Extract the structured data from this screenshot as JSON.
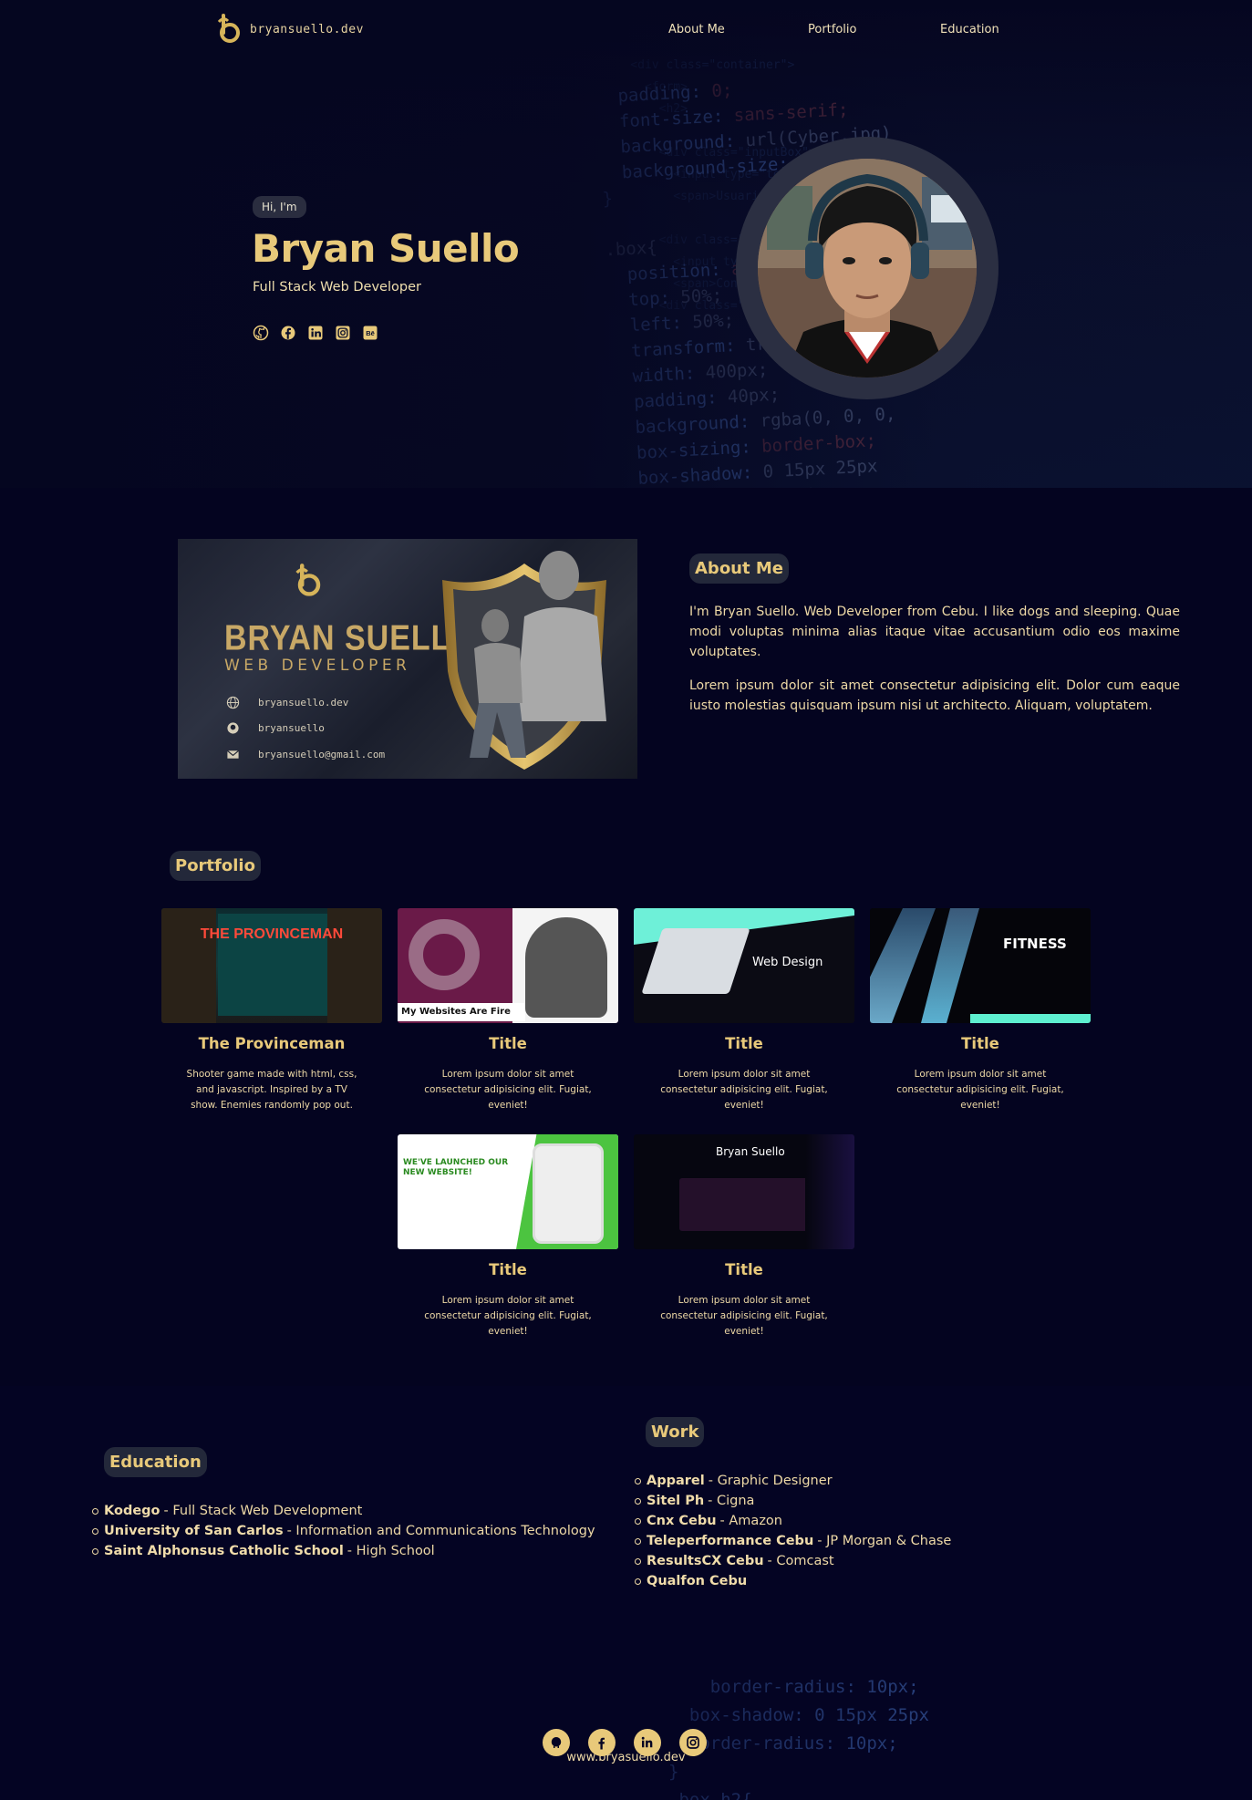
{
  "nav": {
    "logo_text": "bryansuello.dev",
    "links": [
      "About Me",
      "Portfolio",
      "Education"
    ]
  },
  "hero": {
    "greeting": "Hi, I'm",
    "name": "Bryan Suello",
    "role": "Full Stack Web Developer",
    "social_icons": [
      "github-icon",
      "facebook-icon",
      "linkedin-icon",
      "instagram-icon",
      "behance-icon"
    ]
  },
  "business_card": {
    "name": "BRYAN SUELLO",
    "title": "WEB DEVELOPER",
    "lines": [
      "bryansuello.dev",
      "bryansuello",
      "bryansuello@gmail.com"
    ]
  },
  "about": {
    "heading": "About Me",
    "paragraphs": [
      "I'm Bryan Suello. Web Developer from Cebu. I like dogs and sleeping. Quae modi voluptas minima alias itaque vitae accusantium odio eos maxime voluptates.",
      "Lorem ipsum dolor sit amet consectetur adipisicing elit. Dolor cum eaque iusto molestias quisquam ipsum nisi ut architecto. Aliquam, voluptatem."
    ]
  },
  "portfolio": {
    "heading": "Portfolio",
    "items": [
      {
        "title": "The Provinceman",
        "desc": "Shooter game made with html, css, and javascript. Inspired by a TV show. Enemies randomly pop out.",
        "thumb_text": "THE PROVINCEMAN"
      },
      {
        "title": "Title",
        "desc": "Lorem ipsum dolor sit amet consectetur adipisicing elit. Fugiat, eveniet!",
        "thumb_text": "My Websites Are Fire"
      },
      {
        "title": "Title",
        "desc": "Lorem ipsum dolor sit amet consectetur adipisicing elit. Fugiat, eveniet!",
        "thumb_text": "Web Design"
      },
      {
        "title": "Title",
        "desc": "Lorem ipsum dolor sit amet consectetur adipisicing elit. Fugiat, eveniet!",
        "thumb_text": "FITNESS"
      },
      {
        "title": "Title",
        "desc": "Lorem ipsum dolor sit amet consectetur adipisicing elit. Fugiat, eveniet!",
        "thumb_text": "WE'VE LAUNCHED OUR NEW WEBSITE!"
      },
      {
        "title": "Title",
        "desc": "Lorem ipsum dolor sit amet consectetur adipisicing elit. Fugiat, eveniet!",
        "thumb_text": "Bryan Suello"
      }
    ]
  },
  "education": {
    "heading": "Education",
    "items": [
      {
        "school": "Kodego",
        "detail": "- Full Stack Web Development"
      },
      {
        "school": "University of San Carlos",
        "detail": "- Information and Communications Technology"
      },
      {
        "school": "Saint Alphonsus Catholic School",
        "detail": "- High School"
      }
    ]
  },
  "work": {
    "heading": "Work",
    "items": [
      {
        "company": "Apparel",
        "detail": "- Graphic Designer"
      },
      {
        "company": "Sitel Ph",
        "detail": "- Cigna"
      },
      {
        "company": "Cnx Cebu",
        "detail": "- Amazon"
      },
      {
        "company": "Teleperformance Cebu",
        "detail": "- JP Morgan & Chase"
      },
      {
        "company": "ResultsCX Cebu",
        "detail": "- Comcast"
      },
      {
        "company": "Qualfon Cebu",
        "detail": ""
      }
    ]
  },
  "footer": {
    "url": "www.bryasuello.dev",
    "social_icons": [
      "github-icon",
      "facebook-icon",
      "linkedin-icon",
      "instagram-icon"
    ]
  },
  "colors": {
    "accent": "#e8c97a",
    "background": "#040420",
    "pill": "#23283a"
  }
}
